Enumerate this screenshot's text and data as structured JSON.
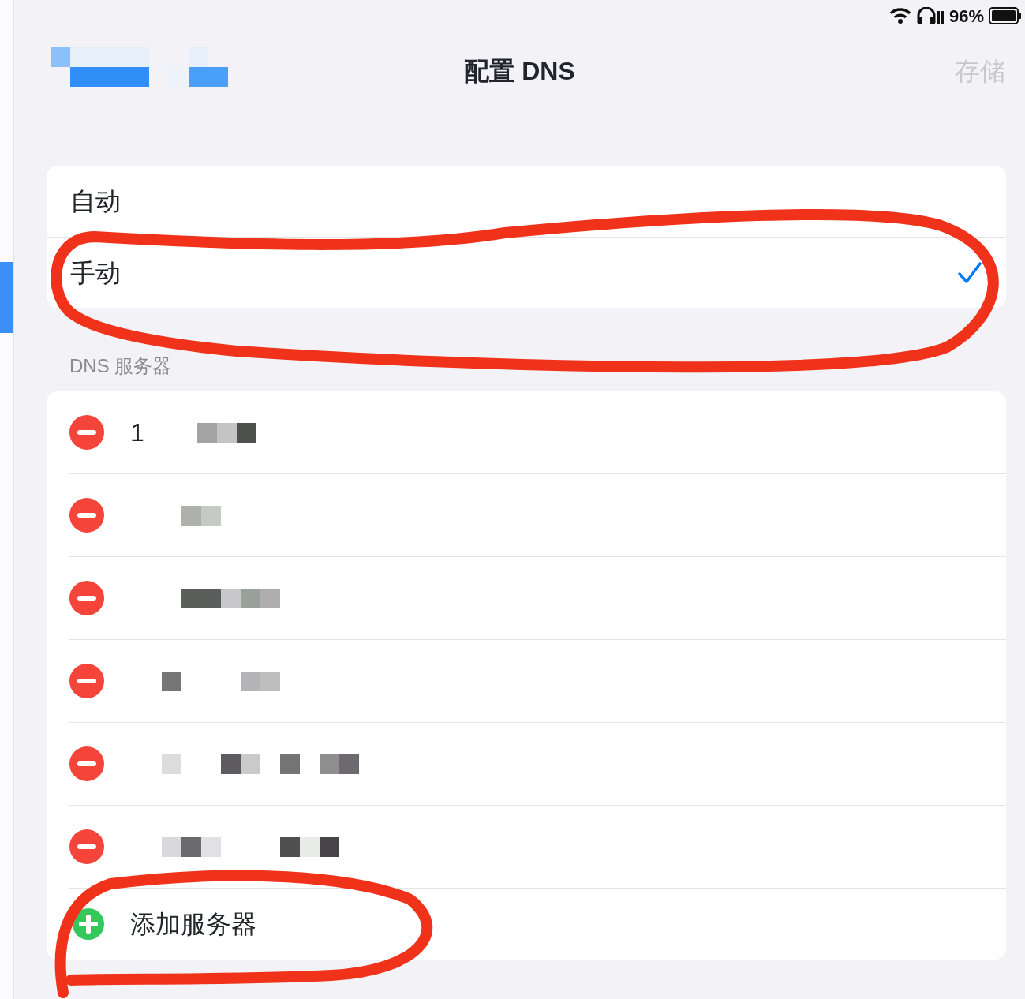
{
  "status_bar": {
    "battery_text": "96%"
  },
  "nav": {
    "title": "配置 DNS",
    "save": {
      "label": "存储",
      "disabled": true
    }
  },
  "modes": [
    {
      "label": "自动",
      "selected": false
    },
    {
      "label": "手动",
      "selected": true
    }
  ],
  "section_header": "DNS 服务器",
  "servers": [
    {
      "kind": "partial",
      "address": "1"
    },
    {
      "kind": "redacted"
    },
    {
      "kind": "redacted"
    },
    {
      "kind": "redacted"
    },
    {
      "kind": "redacted"
    },
    {
      "kind": "redacted"
    }
  ],
  "add_button": "添加服务器"
}
